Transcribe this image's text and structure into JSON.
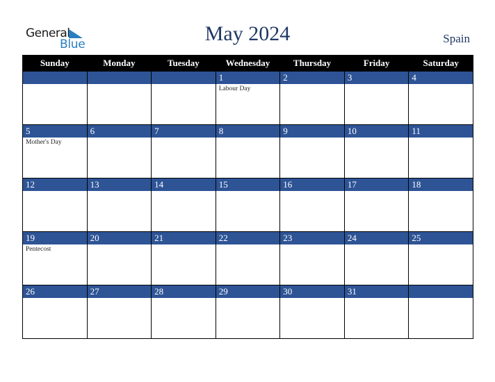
{
  "logo": {
    "word1": "General",
    "word2": "Blue",
    "accent": "#2a7fc1"
  },
  "title": "May 2024",
  "country": "Spain",
  "colors": {
    "header_bg": "#000000",
    "daybar_bg": "#2e5496",
    "title_color": "#1f3864"
  },
  "weekdays": [
    "Sunday",
    "Monday",
    "Tuesday",
    "Wednesday",
    "Thursday",
    "Friday",
    "Saturday"
  ],
  "weeks": [
    [
      {
        "day": ""
      },
      {
        "day": ""
      },
      {
        "day": ""
      },
      {
        "day": "1",
        "event": "Labour Day"
      },
      {
        "day": "2"
      },
      {
        "day": "3"
      },
      {
        "day": "4"
      }
    ],
    [
      {
        "day": "5",
        "event": "Mother's Day"
      },
      {
        "day": "6"
      },
      {
        "day": "7"
      },
      {
        "day": "8"
      },
      {
        "day": "9"
      },
      {
        "day": "10"
      },
      {
        "day": "11"
      }
    ],
    [
      {
        "day": "12"
      },
      {
        "day": "13"
      },
      {
        "day": "14"
      },
      {
        "day": "15"
      },
      {
        "day": "16"
      },
      {
        "day": "17"
      },
      {
        "day": "18"
      }
    ],
    [
      {
        "day": "19",
        "event": "Pentecost"
      },
      {
        "day": "20"
      },
      {
        "day": "21"
      },
      {
        "day": "22"
      },
      {
        "day": "23"
      },
      {
        "day": "24"
      },
      {
        "day": "25"
      }
    ],
    [
      {
        "day": "26"
      },
      {
        "day": "27"
      },
      {
        "day": "28"
      },
      {
        "day": "29"
      },
      {
        "day": "30"
      },
      {
        "day": "31"
      },
      {
        "day": ""
      }
    ]
  ]
}
